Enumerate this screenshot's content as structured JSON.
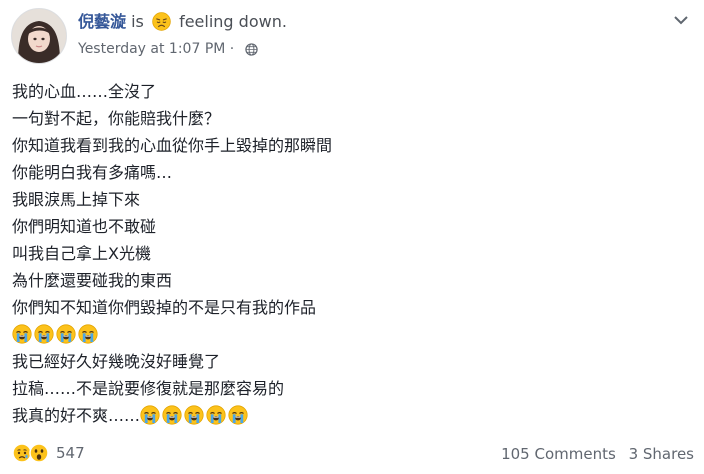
{
  "post": {
    "author": "倪藝漩",
    "is_word": "is",
    "feeling_icon": "disappointed-face-icon",
    "feeling_text": "feeling down.",
    "timestamp": "Yesterday at 1:07 PM",
    "timestamp_dot": "·",
    "privacy_icon": "globe-icon",
    "more_icon": "chevron-down-icon",
    "lines": [
      "我的心血……全沒了",
      "一句對不起，你能賠我什麼？",
      "你知道我看到我的心血從你手上毀掉的那瞬間",
      "你能明白我有多痛嗎…",
      "我眼淚馬上掉下來",
      "你們明知道也不敢碰",
      "叫我自己拿上X光機",
      "為什麼還要碰我的東西",
      "你們知不知道你們毀掉的不是只有我的作品",
      "",
      "我已經好久好幾晚沒好睡覺了",
      "拉稿……不是說要修復就是那麼容易的",
      "我真的好不爽……"
    ],
    "emoji_line_count": 4,
    "trailing_emoji_count": 5,
    "emoji_icon": "loudly-crying-face-icon"
  },
  "footer": {
    "reaction_icons": [
      "sad-reaction-icon",
      "wow-reaction-icon"
    ],
    "reaction_count": "547",
    "comments": "105 Comments",
    "shares": "3 Shares"
  },
  "colors": {
    "name": "#365899",
    "text": "#1d2129",
    "meta": "#616770",
    "emoji_yellow": "#fcc21b"
  }
}
